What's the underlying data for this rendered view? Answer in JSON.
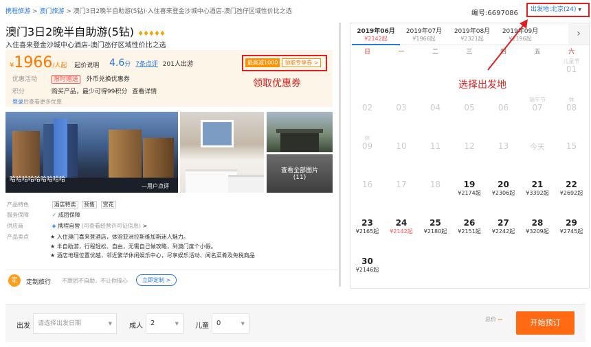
{
  "breadcrumb": {
    "home": "携程旅游",
    "sep": ">",
    "area": "澳门旅游",
    "current": "澳门3日2晚半自助游(5钻)·入住喜来登金沙城中心酒店-澳门氹仔区域性价比之选"
  },
  "product_no": "编号:6697086",
  "departure": {
    "label": "出发地:北京(24)",
    "caret": "▼"
  },
  "title": {
    "text": "澳门3日2晚半自助游(5钻)",
    "stars": "♦♦♦♦♦"
  },
  "subtitle": "入住喜来登金沙城中心酒店-澳门氹仔区域性价比之选",
  "price": {
    "currency": "¥",
    "amount": "1966",
    "unit": "/人起",
    "note": "起价说明"
  },
  "rating": {
    "score": "4.6",
    "unit": "分",
    "comments": "7条点评",
    "travelers": "201人出游"
  },
  "promo": {
    "tag": "最高减1000",
    "link": "领取专享券 >"
  },
  "annotations": {
    "coupon": "领取优惠券",
    "departure": "选择出发地"
  },
  "offer": {
    "label": "优惠活动",
    "tag": "限时赠送",
    "text": "外币兑换优惠券"
  },
  "points": {
    "label": "积分",
    "text": "购买产品，最少可得99积分",
    "link": "查看详情"
  },
  "login": {
    "link": "登录",
    "text": "后查看更多优惠"
  },
  "gallery": {
    "caption": "哈哈哈哈哈哈哈哈哈",
    "review": "—用户点评",
    "all_photos": "查看全部图片",
    "count": "(11)"
  },
  "features": {
    "label": "产品特色",
    "chips": [
      "酒店特卖",
      "预售",
      "赏花"
    ]
  },
  "guarantee": {
    "label": "服务保障",
    "icon": "check-circle-icon",
    "text": "成团保障"
  },
  "supplier": {
    "label": "供应商",
    "text": "携程自营",
    "note": "(可查看经营许可证信息)",
    "arrow": ">"
  },
  "highlights": {
    "label": "产品卖点",
    "items": [
      "★ 入住澳门喜来登酒店，体验亚洲拉斯维加斯迷人魅力。",
      "★ 半自助游，行程轻松、自由，无需自己做攻略，到澳门度个小假。",
      "★ 酒店地理位置优越，邻近繁华休闲娱乐中心，尽享娱乐活动、闻名菜肴及免税商品"
    ]
  },
  "custom": {
    "icon": "定",
    "title": "定制旅行",
    "desc": "不跟团不自助，不让你操心",
    "button": "立即定制 >"
  },
  "calendar": {
    "months": [
      {
        "m": "2019年06月",
        "p": "¥2142起"
      },
      {
        "m": "2019年07月",
        "p": "¥1966起"
      },
      {
        "m": "2019年08月",
        "p": "¥2321起"
      },
      {
        "m": "2019年09月",
        "p": "¥2196起"
      }
    ],
    "next": "›",
    "weekdays": [
      "日",
      "一",
      "二",
      "三",
      "四",
      "五",
      "六"
    ],
    "cells": [
      {
        "n": "01",
        "h": "儿童节",
        "p": "",
        "on": false
      },
      {
        "n": "02",
        "h": "",
        "p": "",
        "on": false
      },
      {
        "n": "03",
        "h": "",
        "p": "",
        "on": false
      },
      {
        "n": "04",
        "h": "",
        "p": "",
        "on": false
      },
      {
        "n": "05",
        "h": "",
        "p": "",
        "on": false
      },
      {
        "n": "06",
        "h": "",
        "p": "",
        "on": false
      },
      {
        "n": "07",
        "h": "端午节",
        "p": "",
        "on": false
      },
      {
        "n": "08",
        "h": "休",
        "p": "",
        "on": false
      },
      {
        "n": "09",
        "h": "休",
        "p": "",
        "on": false
      },
      {
        "n": "10",
        "h": "",
        "p": "",
        "on": false
      },
      {
        "n": "11",
        "h": "",
        "p": "",
        "on": false
      },
      {
        "n": "12",
        "h": "",
        "p": "",
        "on": false
      },
      {
        "n": "13",
        "h": "",
        "p": "",
        "on": false
      },
      {
        "n": "今天",
        "h": "",
        "p": "",
        "on": false
      },
      {
        "n": "15",
        "h": "",
        "p": "",
        "on": false
      },
      {
        "n": "16",
        "h": "",
        "p": "",
        "on": false
      },
      {
        "n": "17",
        "h": "",
        "p": "",
        "on": false
      },
      {
        "n": "18",
        "h": "",
        "p": "",
        "on": false
      },
      {
        "n": "19",
        "h": "",
        "p": "¥2174起",
        "on": true
      },
      {
        "n": "20",
        "h": "",
        "p": "¥2306起",
        "on": true
      },
      {
        "n": "21",
        "h": "",
        "p": "¥3392起",
        "on": true
      },
      {
        "n": "22",
        "h": "",
        "p": "¥2692起",
        "on": true
      },
      {
        "n": "23",
        "h": "",
        "p": "¥2165起",
        "on": true
      },
      {
        "n": "24",
        "h": "",
        "p": "¥2142起",
        "on": true,
        "red": true
      },
      {
        "n": "25",
        "h": "",
        "p": "¥2180起",
        "on": true
      },
      {
        "n": "26",
        "h": "",
        "p": "¥2151起",
        "on": true
      },
      {
        "n": "27",
        "h": "",
        "p": "¥2242起",
        "on": true
      },
      {
        "n": "28",
        "h": "",
        "p": "¥3209起",
        "on": true
      },
      {
        "n": "29",
        "h": "",
        "p": "¥2745起",
        "on": true
      },
      {
        "n": "30",
        "h": "",
        "p": "¥2146起",
        "on": true
      }
    ]
  },
  "booking": {
    "depart_label": "出发",
    "depart_placeholder": "请选择出发日期",
    "adult_label": "成人",
    "adult_value": "2",
    "child_label": "儿童",
    "child_value": "0",
    "total_label": "总价",
    "total_value": "--",
    "book": "开始预订"
  }
}
